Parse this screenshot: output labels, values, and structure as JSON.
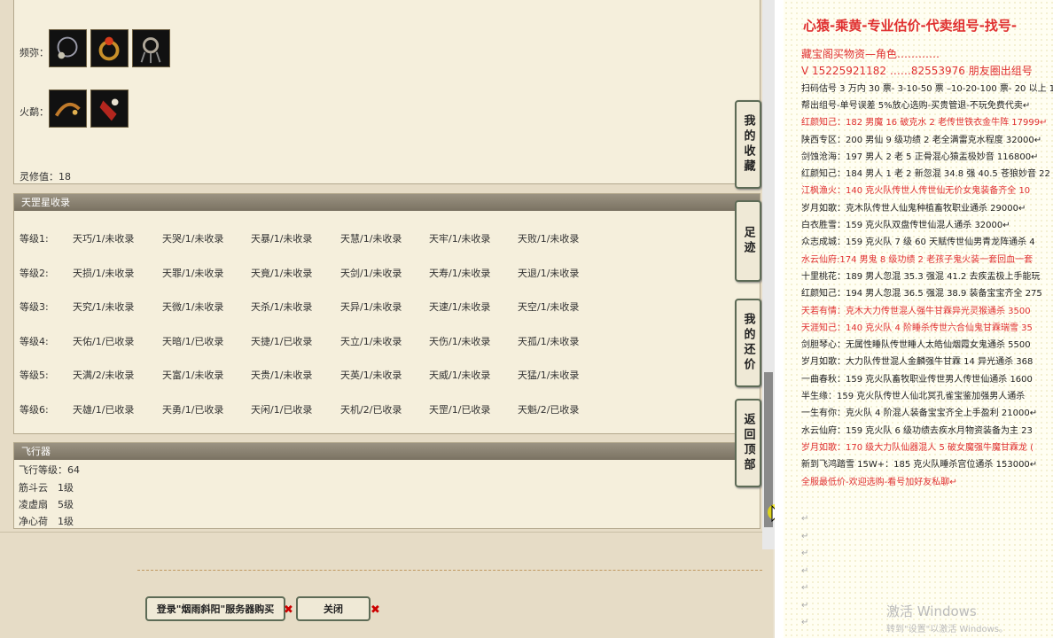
{
  "jewelry_label": "频弥：",
  "fire_label": "火鹬：",
  "spirit_value": "灵修值：18",
  "tiangang": {
    "title": "天罡星收录",
    "rows": [
      {
        "level": "等级1:",
        "cells": [
          "天巧/1/未收录",
          "天哭/1/未收录",
          "天暴/1/未收录",
          "天慧/1/未收录",
          "天牢/1/未收录",
          "天败/1/未收录"
        ]
      },
      {
        "level": "等级2:",
        "cells": [
          "天损/1/未收录",
          "天罪/1/未收录",
          "天竟/1/未收录",
          "天剑/1/未收录",
          "天寿/1/未收录",
          "天退/1/未收录"
        ]
      },
      {
        "level": "等级3:",
        "cells": [
          "天究/1/未收录",
          "天微/1/未收录",
          "天杀/1/未收录",
          "天异/1/未收录",
          "天速/1/未收录",
          "天空/1/未收录"
        ]
      },
      {
        "level": "等级4:",
        "cells": [
          "天佑/1/已收录",
          "天暗/1/已收录",
          "天捷/1/已收录",
          "天立/1/未收录",
          "天伤/1/未收录",
          "天孤/1/未收录"
        ]
      },
      {
        "level": "等级5:",
        "cells": [
          "天满/2/未收录",
          "天富/1/未收录",
          "天贵/1/未收录",
          "天英/1/未收录",
          "天威/1/未收录",
          "天猛/1/未收录"
        ]
      },
      {
        "level": "等级6:",
        "cells": [
          "天雄/1/已收录",
          "天勇/1/已收录",
          "天闲/1/已收录",
          "天机/2/已收录",
          "天罡/1/已收录",
          "天魁/2/已收录"
        ]
      }
    ]
  },
  "flight": {
    "title": "飞行器",
    "lines": [
      "飞行等级：64",
      "筋斗云　1级",
      "凌虚扇　5级",
      "净心荷　1级"
    ]
  },
  "side_tabs": [
    "我的收藏",
    "足迹",
    "我的还价",
    "返回顶部"
  ],
  "buttons": {
    "buy": "登录\"烟雨斜阳\"服务器购买",
    "close": "关闭"
  },
  "doc": {
    "title": "心猿-乘黄-专业估价-代卖组号-找号-",
    "lines": [
      {
        "text": "藏宝阁买物资—角色…………",
        "red": true
      },
      {
        "text": "V 15225921182 ……82553976 朋友圈出组号",
        "red": true
      },
      {
        "text": "扫码估号 3 万内 30 票- 3-10-50 票  –10-20-100 票- 20 以上 1",
        "red": false
      },
      {
        "text": "帮出组号-单号误差 5%放心选购-买贵管退-不玩免费代卖↵",
        "red": false
      },
      {
        "text": "红颜知己：182 男魔 16 破克水 2 老传世铁衣金牛阵 17999↵",
        "red": true
      },
      {
        "text": "陕西专区：200 男仙 9 级功绩 2 老全满雷克水程度 32000↵",
        "red": false
      },
      {
        "text": "剑蚀沧海：197 男人 2 老 5 正骨混心猿盂极妙音 116800↵",
        "red": false
      },
      {
        "text": "红颜知己：184 男人 1 老 2 新忽混 34.8 强 40.5 苍狼妙音 22",
        "red": false
      },
      {
        "text": "江枫渔火：140 克火队传世人传世仙无价女鬼装备齐全 10",
        "red": true
      },
      {
        "text": "岁月如歌：克木队传世人仙鬼种植畜牧职业通杀 29000↵",
        "red": false
      },
      {
        "text": "白衣胜雪：159 克火队双盘传世仙混人通杀 32000↵",
        "red": false
      },
      {
        "text": "众志成城：159 克火队 7 级 60 天赋传世仙男青龙阵通杀 4",
        "red": false
      },
      {
        "text": "水云仙府:174 男鬼 8 级功绩 2 老孩子鬼火装一套回血一套",
        "red": true
      },
      {
        "text": "十里桃花：189 男人忽混 35.3 强混 41.2 去疾盂极上手能玩",
        "red": false
      },
      {
        "text": "红颜知己：194 男人忽混 36.5 强混 38.9 装备宝宝齐全 275",
        "red": false
      },
      {
        "text": "天若有情：克木大力传世混人强牛甘霖异光灵猴通杀 3500",
        "red": true
      },
      {
        "text": "天涯知己：140 克火队 4 阶睡杀传世六合仙鬼甘霖瑞雪 35",
        "red": true
      },
      {
        "text": "剑胆琴心：无属性睡队传世睡人太皓仙烟霞女鬼通杀 5500",
        "red": false
      },
      {
        "text": "岁月如歌：大力队传世混人金麟强牛甘霖 14 异光通杀 368",
        "red": false
      },
      {
        "text": "一曲春秋：159 克火队畜牧职业传世男人传世仙通杀 1600",
        "red": false
      },
      {
        "text": "半生缘：159 克火队传世人仙北冥孔雀宝鉴加强男人通杀",
        "red": false
      },
      {
        "text": "一生有你：克火队 4 阶混人装备宝宝齐全上手盈利 21000↵",
        "red": false
      },
      {
        "text": "水云仙府：159 克火队 6 级功绩去疾水月物资装备为主 23",
        "red": false
      },
      {
        "text": "岁月如歌：170 级大力队仙器混人 5 破女魔强牛魔甘霖龙 (",
        "red": true
      },
      {
        "text": "新到飞鸿踏雪 15W+：185 克火队睡杀宫位通杀 153000↵",
        "red": false
      },
      {
        "text": "全服最低价-欢迎选购-看号加好友私聊↵",
        "red": true
      }
    ]
  },
  "watermark": {
    "line1": "激活 Windows",
    "line2": "转到\"设置\"以激活 Windows。"
  },
  "colors": {
    "accent_red": "#e03030",
    "panel_bg": "#f5efdc",
    "header_bg": "#8a8272"
  }
}
